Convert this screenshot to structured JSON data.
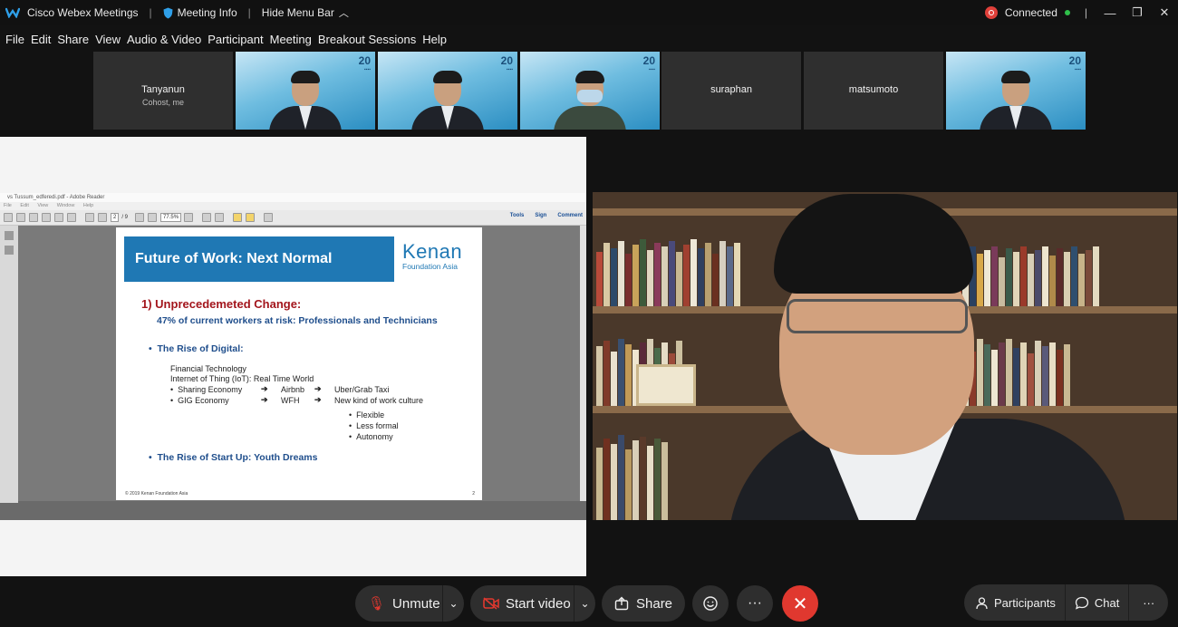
{
  "titlebar": {
    "app_name": "Cisco Webex Meetings",
    "meeting_info": "Meeting Info",
    "hide_menu_bar": "Hide Menu Bar",
    "status": "Connected",
    "colors": {
      "status_red": "#e0403a",
      "status_green": "#2fbf4a"
    }
  },
  "menu": {
    "file": "File",
    "edit": "Edit",
    "share": "Share",
    "view": "View",
    "audio_video": "Audio & Video",
    "participant": "Participant",
    "meeting": "Meeting",
    "breakout": "Breakout Sessions",
    "help": "Help"
  },
  "participants": {
    "p1_name": "Tanyanun",
    "p1_role": "Cohost, me",
    "p5_name": "suraphan",
    "p6_name": "matsumoto"
  },
  "reader": {
    "title": "vs Tussum_edferedi.pdf - Adobe Reader",
    "menu": [
      "File",
      "Edit",
      "View",
      "Window",
      "Help"
    ],
    "page_current": "2",
    "page_total": "/ 9",
    "zoom": "77.5%",
    "tools": "Tools",
    "sign": "Sign",
    "comment": "Comment"
  },
  "slide": {
    "title": "Future of Work: Next Normal",
    "logo_main": "Kenan",
    "logo_sub": "Foundation Asia",
    "heading": "1) Unprecedemeted Change:",
    "subheading": "47% of current workers at risk: Professionals and Technicians",
    "bullet_digital": "The Rise of Digital:",
    "line_fintech": "Financial Technology",
    "line_iot": "Internet of Thing (IoT): Real Time World",
    "sharing": "Sharing Economy",
    "airbnb": "Airbnb",
    "uber": "Uber/Grab Taxi",
    "gig": "GIG Economy",
    "wfh": "WFH",
    "new_culture": "New kind of work culture",
    "flexible": "Flexible",
    "less_formal": "Less formal",
    "autonomy": "Autonomy",
    "bullet_startup": "The Rise of Start Up: Youth Dreams",
    "footer": "© 2019 Kenan Foundation Asia",
    "page_no": "2",
    "colors": {
      "banner": "#1f78b4",
      "heading": "#a3151c",
      "blue_text": "#1f4e8c"
    }
  },
  "controls": {
    "unmute": "Unmute",
    "start_video": "Start video",
    "share": "Share",
    "participants": "Participants",
    "chat": "Chat",
    "colors": {
      "end_call": "#e0382f",
      "mute_icon": "#e0382f"
    }
  }
}
